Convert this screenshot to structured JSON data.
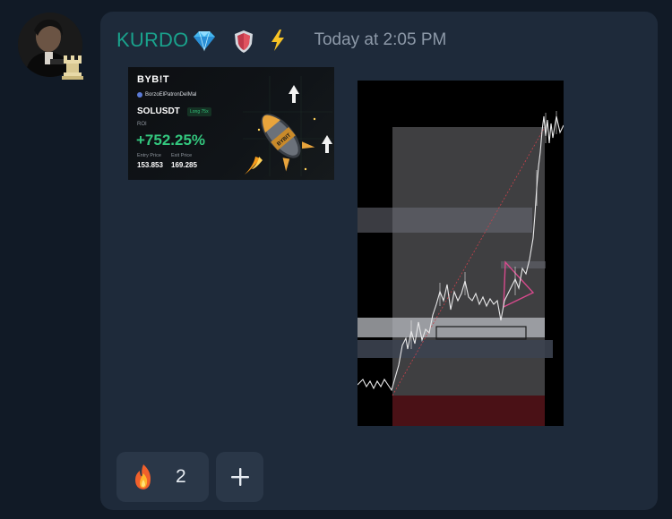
{
  "message": {
    "username": "KURDO",
    "timestamp": "Today at 2:05 PM",
    "badges": [
      "gem-icon",
      "shield-icon",
      "lightning-icon"
    ],
    "colors": {
      "username": "#1aa28c",
      "card_background": "#1e2a3a",
      "page_background": "#111a26",
      "timestamp": "#8d99a8"
    }
  },
  "bybit_card": {
    "logo": "BYB!T",
    "trader": "BorzoElPatronDelMal",
    "pair": "SOLUSDT",
    "position": "Long 75x",
    "roi_label": "ROI",
    "roi": "+752.25%",
    "entry_label": "Entry Price",
    "exit_label": "Exit Price",
    "entry_price": "153.853",
    "exit_price": "169.285",
    "rocket_text": "BYBIT"
  },
  "reactions": [
    {
      "emoji": "fire-icon",
      "count": "2"
    }
  ],
  "add_reaction": {
    "icon": "plus-icon"
  }
}
